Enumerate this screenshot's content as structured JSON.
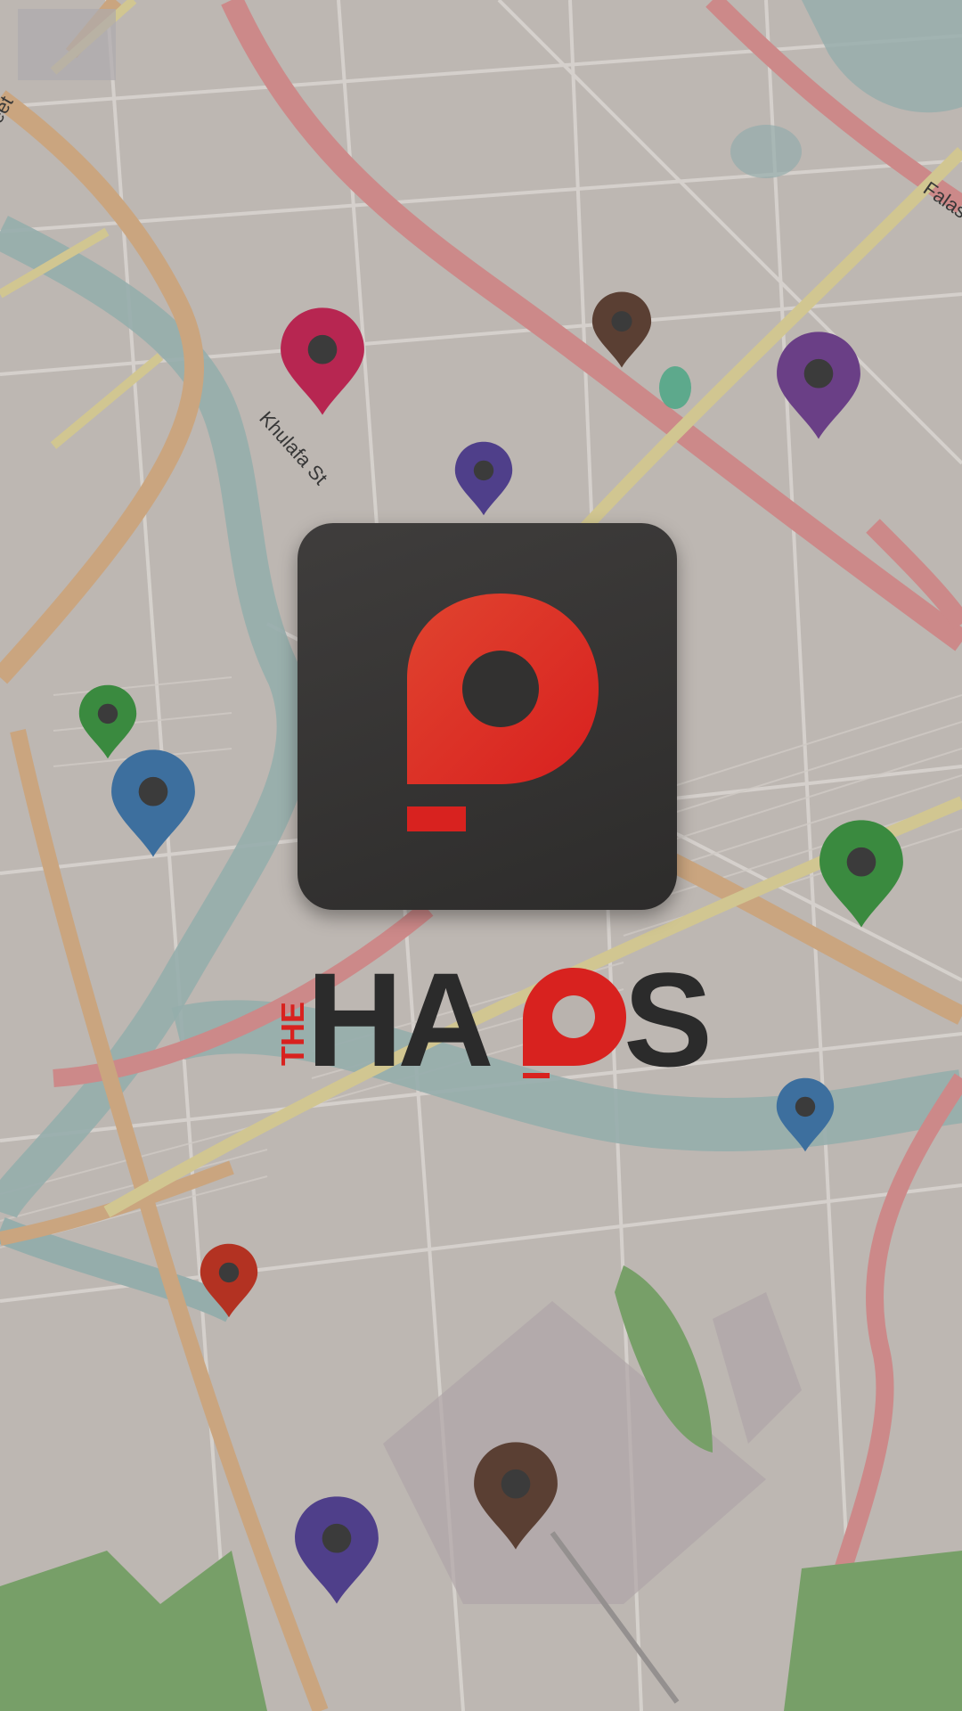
{
  "app": {
    "name_prefix": "THE",
    "name_part1": "HA",
    "name_part2": "S"
  },
  "map": {
    "street_labels": [
      "Khulafa St",
      "Falast",
      "eet"
    ]
  },
  "colors": {
    "brand_red": "#e02a25",
    "icon_dark": "#2f2e2d",
    "map_base": "#b9b3ae",
    "river": "#8fa8a6",
    "main_road": "#c7a078",
    "highway": "#c98282",
    "park": "#6f9a5f"
  },
  "pins": [
    {
      "name": "pin-crimson",
      "color": "#b72651"
    },
    {
      "name": "pin-brown-small",
      "color": "#5a3f33"
    },
    {
      "name": "pin-purple-large",
      "color": "#6a3f86"
    },
    {
      "name": "pin-indigo-small",
      "color": "#4f3f8a"
    },
    {
      "name": "pin-green-small",
      "color": "#3a8a3f"
    },
    {
      "name": "pin-blue-large",
      "color": "#3d6f9e"
    },
    {
      "name": "pin-green-large",
      "color": "#3a8a3f"
    },
    {
      "name": "pin-blue-small",
      "color": "#3d6f9e"
    },
    {
      "name": "pin-red-small",
      "color": "#b33222"
    },
    {
      "name": "pin-brown-large",
      "color": "#5a3f33"
    },
    {
      "name": "pin-indigo-large",
      "color": "#4f3f8a"
    }
  ]
}
